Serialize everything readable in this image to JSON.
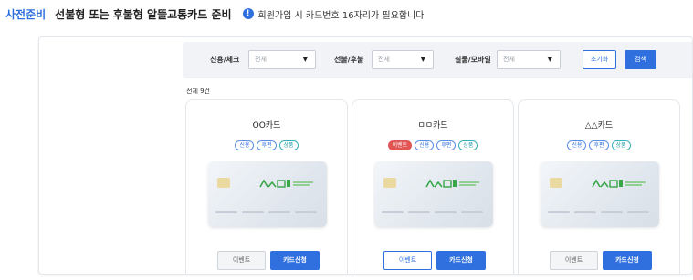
{
  "header": {
    "prep_label": "사전준비",
    "title": "선불형 또는 후불형 알뜰교통카드 준비",
    "notice_icon": "!",
    "notice": "회원가입 시 카드번호 16자리가 필요합니다"
  },
  "filters": {
    "credit_check": {
      "label": "신용/체크",
      "value": "전체"
    },
    "prepaid_postpaid": {
      "label": "선불/후불",
      "value": "전체"
    },
    "physical_mobile": {
      "label": "실물/모바일",
      "value": "전체"
    },
    "reset_label": "초기화",
    "search_label": "검색"
  },
  "total_count": "전체 9건",
  "cards": [
    {
      "name": "OO카드",
      "tags": [
        "신용",
        "후편",
        "상품"
      ],
      "has_event": false,
      "event_button": "이벤트",
      "apply_button": "카드신청"
    },
    {
      "name": "ㅁㅁ카드",
      "tags": [
        "이벤트",
        "신용",
        "후편",
        "상품"
      ],
      "has_event": true,
      "event_button": "이벤트",
      "apply_button": "카드신청"
    },
    {
      "name": "△△카드",
      "tags": [
        "신용",
        "후편",
        "상품"
      ],
      "has_event": false,
      "event_button": "이벤트",
      "apply_button": "카드신청"
    }
  ],
  "colors": {
    "accent": "#2f6fde",
    "event": "#e25555",
    "teal": "#36b1b8"
  }
}
